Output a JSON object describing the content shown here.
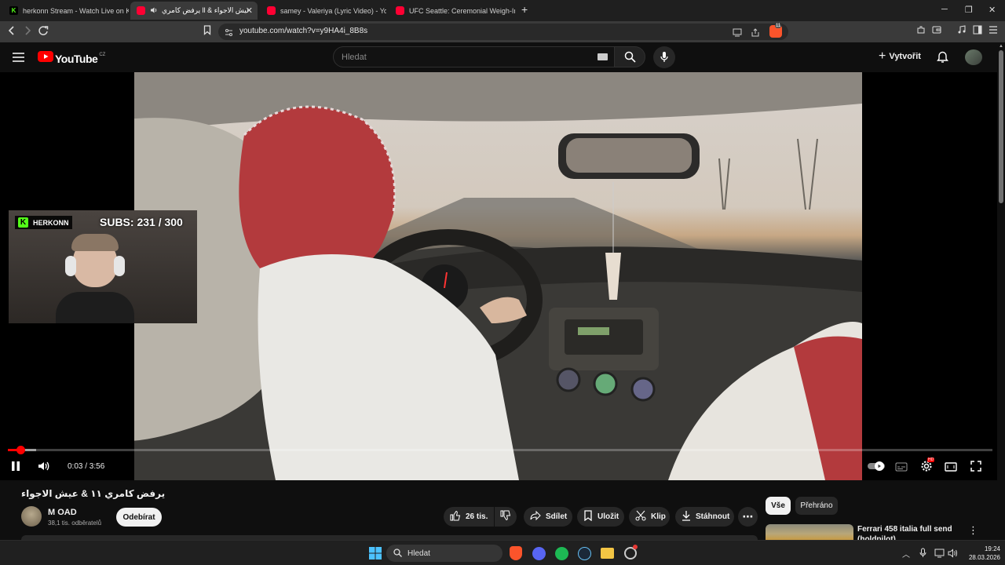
{
  "browser": {
    "tabs": [
      {
        "title": "herkonn Stream - Watch Live on Kick",
        "favicon": "kick-icon"
      },
      {
        "title": "يرفض كامري ll & عيش الاجواء",
        "favicon": "youtube-icon",
        "active": true,
        "audio": true
      },
      {
        "title": "samey - Valeriya (Lyric Video) - YouTu",
        "favicon": "youtube-icon"
      },
      {
        "title": "UFC Seattle: Ceremonial Weigh-In - Y",
        "favicon": "youtube-icon"
      }
    ],
    "url": "youtube.com/watch?v=y9HA4i_8B8s",
    "brave_badge_count": "11"
  },
  "youtube": {
    "logo_text": "YouTube",
    "region": "CZ",
    "search_placeholder": "Hledat",
    "create_label": "Vytvořit"
  },
  "overlay": {
    "channel_tag": "HERKONN",
    "subs_text": "SUBS: 231 / 300"
  },
  "player": {
    "time_current": "0:03",
    "time_total": "3:56",
    "time_display": "0:03 / 3:56",
    "progress_fraction": 0.013,
    "buffer_fraction": 0.029,
    "hd_badge": "HD"
  },
  "video": {
    "title": "يرفض كامري ١١ & عيش الاجواء",
    "channel_name": "M OAD",
    "subscribers": "38,1 tis. odběratelů",
    "subscribe_label": "Odebírat",
    "likes": "26 tis.",
    "share_label": "Sdílet",
    "save_label": "Uložit",
    "clip_label": "Klip",
    "download_label": "Stáhnout"
  },
  "sidebar": {
    "chips": [
      "Vše",
      "Přehráno"
    ],
    "recommendation_title": "Ferrari 458 italia full send (holdpilot)"
  },
  "taskbar": {
    "search_label": "Hledat",
    "time": "19:24",
    "date": "28.03.2026"
  },
  "colors": {
    "accent_red": "#ff0000",
    "kick_green": "#53fc18",
    "background": "#0f0f0f"
  }
}
